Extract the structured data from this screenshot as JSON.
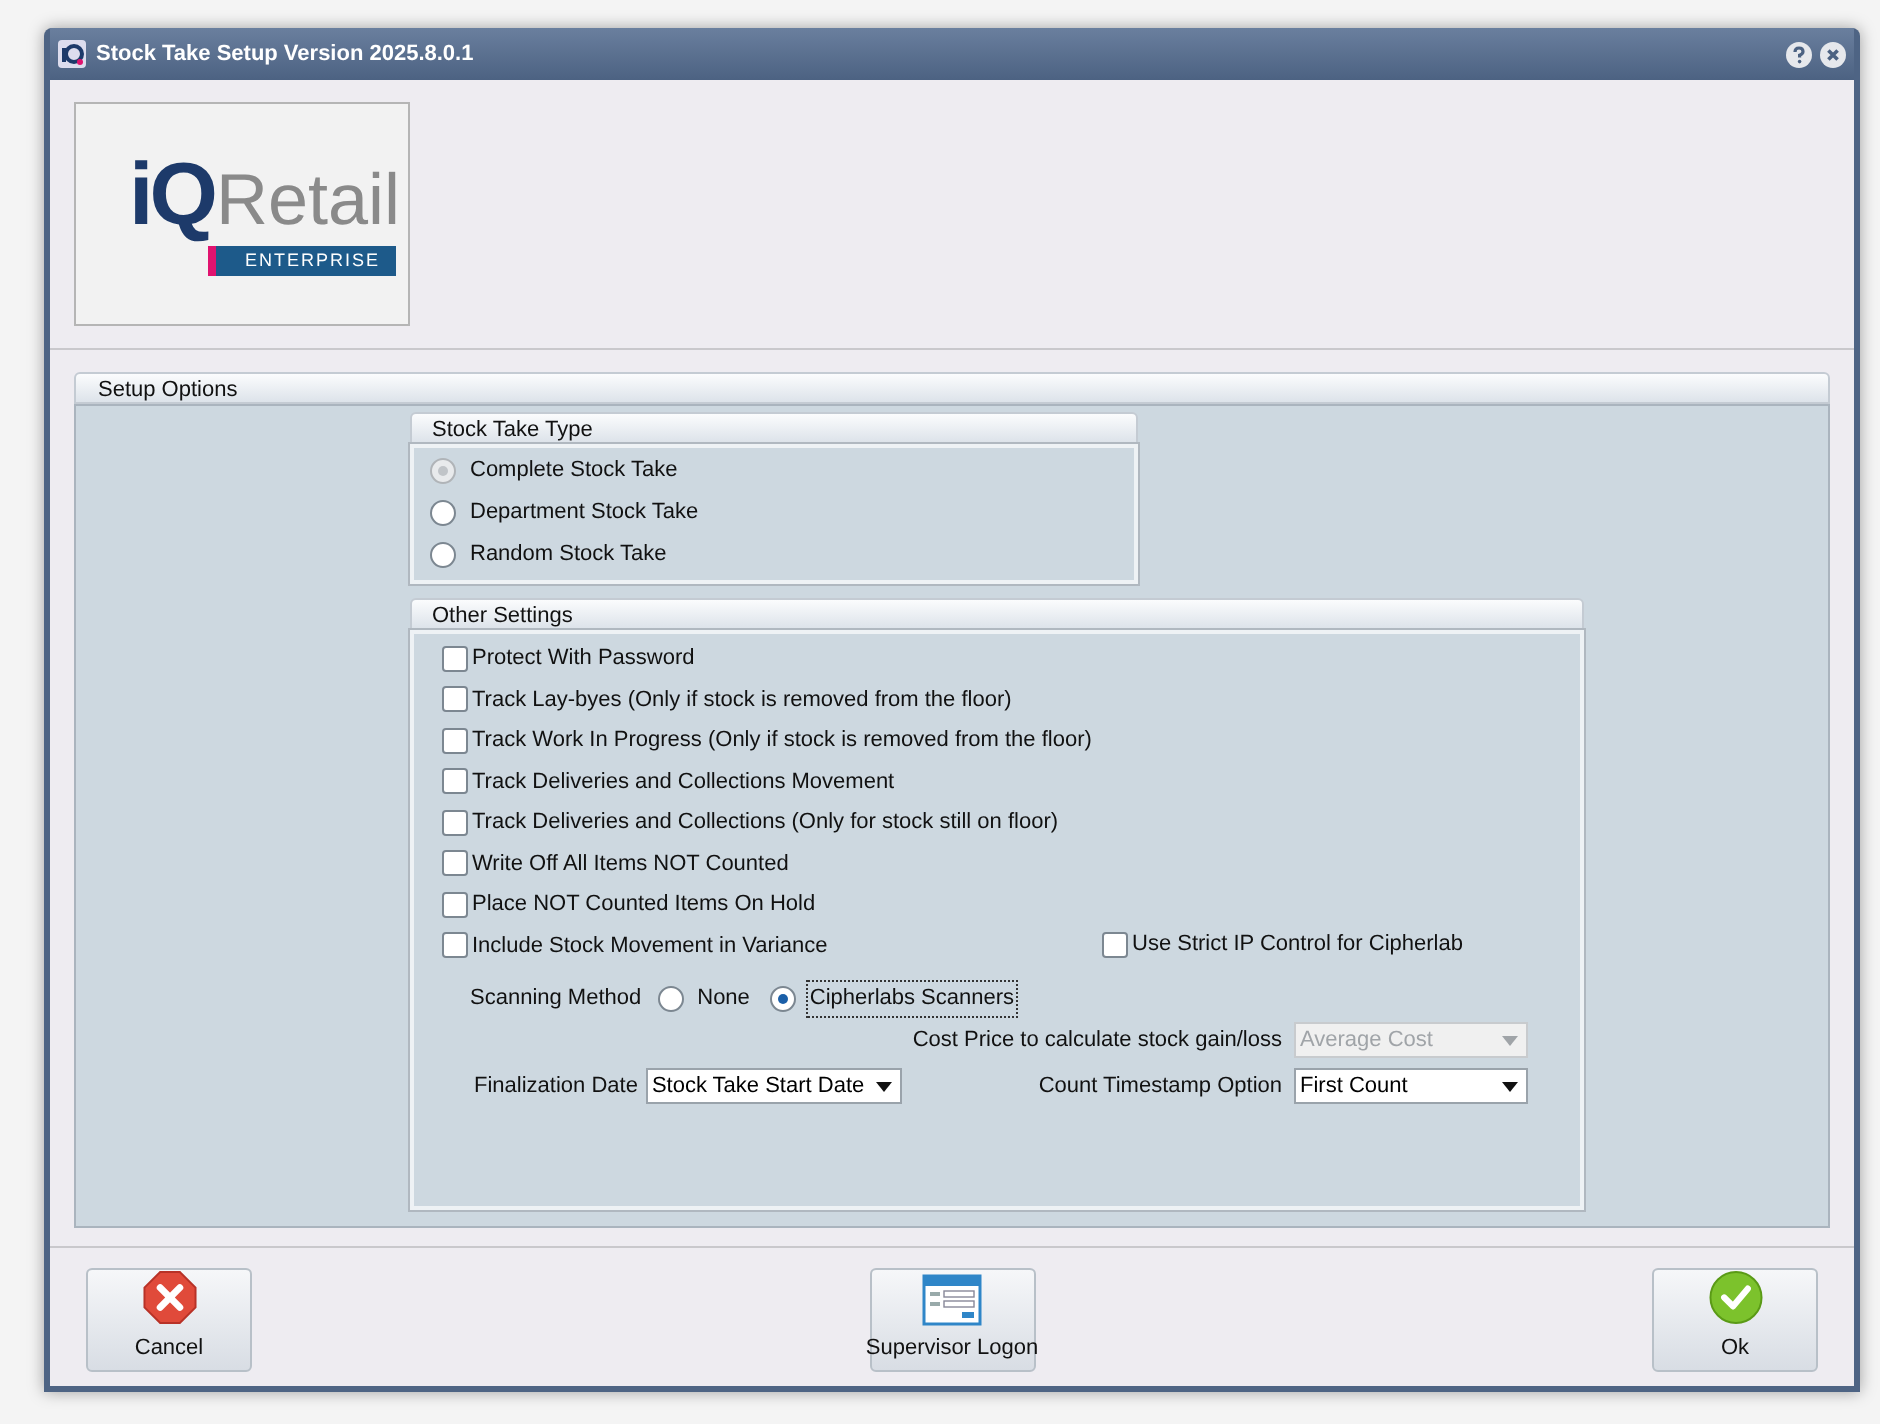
{
  "window": {
    "title": "Stock Take Setup Version 2025.8.0.1"
  },
  "logo": {
    "mark": "iQ",
    "word": "Retail",
    "tag": "ENTERPRISE"
  },
  "setup_options": {
    "title": "Setup Options",
    "stock_take_type": {
      "title": "Stock Take Type",
      "options": [
        {
          "label": "Complete Stock Take",
          "selected": true,
          "disabled": true
        },
        {
          "label": "Department Stock Take",
          "selected": false,
          "disabled": false
        },
        {
          "label": "Random Stock Take",
          "selected": false,
          "disabled": false
        }
      ]
    },
    "other_settings": {
      "title": "Other Settings",
      "checkboxes": [
        {
          "label": "Protect With Password",
          "checked": false
        },
        {
          "label": "Track Lay-byes (Only if stock is removed from the floor)",
          "checked": false
        },
        {
          "label": "Track Work In Progress (Only if stock is removed from the floor)",
          "checked": false
        },
        {
          "label": "Track Deliveries and Collections Movement",
          "checked": false
        },
        {
          "label": "Track Deliveries and Collections (Only for stock still on floor)",
          "checked": false
        },
        {
          "label": "Write Off All Items NOT Counted",
          "checked": false
        },
        {
          "label": "Place NOT Counted Items On Hold",
          "checked": false
        },
        {
          "label": "Include Stock Movement in Variance",
          "checked": false
        }
      ],
      "strict_ip": {
        "label": "Use Strict IP Control for Cipherlab",
        "checked": false
      },
      "scanning_method": {
        "label": "Scanning Method",
        "options": [
          {
            "label": "None",
            "selected": false,
            "focused": false
          },
          {
            "label": "Cipherlabs Scanners",
            "selected": true,
            "focused": true
          }
        ]
      },
      "cost_price": {
        "label": "Cost Price to calculate stock gain/loss",
        "value": "Average Cost",
        "disabled": true
      },
      "finalization_date": {
        "label": "Finalization Date",
        "value": "Stock Take Start Date",
        "disabled": false
      },
      "count_timestamp": {
        "label": "Count Timestamp Option",
        "value": "First Count",
        "disabled": false
      }
    }
  },
  "buttons": [
    {
      "kind": "cancel",
      "label": "Cancel"
    },
    {
      "kind": "logon",
      "label": "Supervisor Logon"
    },
    {
      "kind": "ok",
      "label": "Ok"
    }
  ]
}
